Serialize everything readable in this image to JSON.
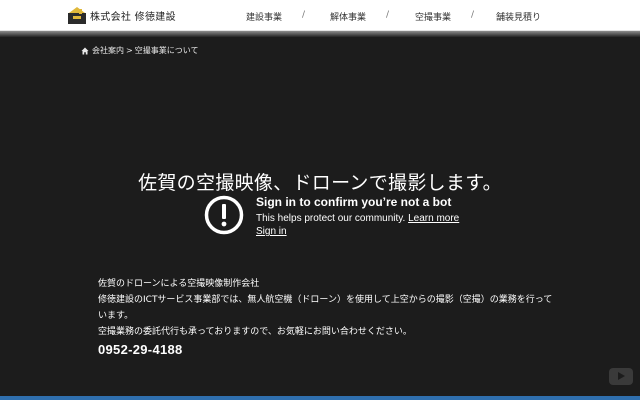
{
  "header": {
    "company_name": "株式会社 修徳建設",
    "nav": [
      {
        "label": "建設事業"
      },
      {
        "label": "解体事業"
      },
      {
        "label": "空撮事業"
      },
      {
        "label": "舗装見積り"
      }
    ],
    "separator": "/"
  },
  "breadcrumb": {
    "home_label": "会社案内",
    "separator": ">",
    "current": "空撮事業について"
  },
  "hero": {
    "title": "佐賀の空撮映像、ドローンで撮影します。"
  },
  "bot_check": {
    "heading": "Sign in to confirm you’re not a bot",
    "message": "This helps protect our community.",
    "learn_more": "Learn more",
    "sign_in": "Sign in",
    "icon": "alert-circle-icon"
  },
  "info": {
    "line1": "佐賀のドローンによる空撮映像制作会社",
    "line2": "修徳建設のICTサービス事業部では、無人航空機（ドローン）を使用して上空からの撮影（空撮）の業務を行って",
    "line3": "います。",
    "line4": "空撮業務の委託代行も承っておりますので、お気軽にお問い合わせください。",
    "phone": "0952-29-4188"
  },
  "colors": {
    "background": "#1c1c1c",
    "header": "#ffffff",
    "accent": "#2f6fae",
    "logo_gold": "#e0b83a"
  }
}
